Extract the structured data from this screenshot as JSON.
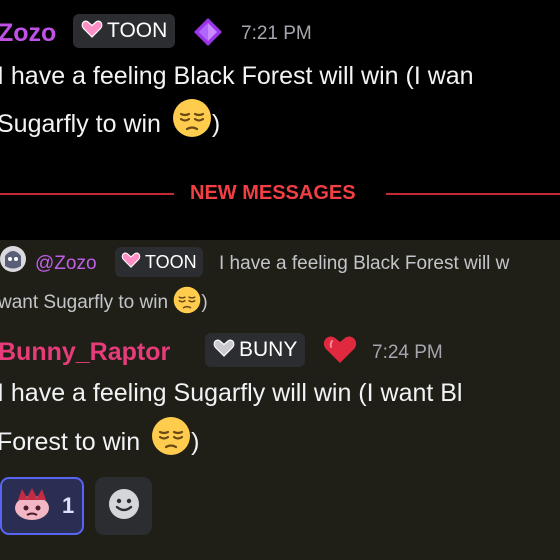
{
  "colors": {
    "background": "#000000",
    "highlight_background": "#1f1e17",
    "zozo_name": "#c050e6",
    "bunny_name": "#e63c7a",
    "new_messages_red": "#f23f43",
    "timestamp": "#a6a6ae"
  },
  "message_1": {
    "username": "Zozo",
    "tag": {
      "icon": "pink-heart-icon",
      "label": "TOON"
    },
    "badge_icon": "purple-gem-icon",
    "timestamp": "7:21 PM",
    "lines": [
      "I have a feeling Black Forest will win (I wan",
      "Sugarfly to win"
    ],
    "emoji": "pensive-face-icon"
  },
  "divider": {
    "label": "NEW MESSAGES"
  },
  "message_2": {
    "reply": {
      "avatar_icon": "reply-avatar-icon",
      "mention": "@Zozo",
      "tag": {
        "icon": "pink-heart-icon",
        "label": "TOON"
      },
      "lines": [
        "I have a feeling Black Forest will w",
        "want Sugarfly to win"
      ],
      "emoji": "pensive-face-icon"
    },
    "username": "Bunny_Raptor",
    "tag": {
      "icon": "grey-heart-icon",
      "label": "BUNY"
    },
    "badge_icon": "red-heart-icon",
    "timestamp": "7:24 PM",
    "lines": [
      "I have a feeling Sugarfly will win (I want Bl",
      "Forest to win"
    ],
    "emoji": "pensive-face-icon",
    "reactions": [
      {
        "icon": "custom-emoji-reaction-icon",
        "count": "1"
      }
    ],
    "add_reaction_icon": "add-reaction-smiley-icon"
  }
}
